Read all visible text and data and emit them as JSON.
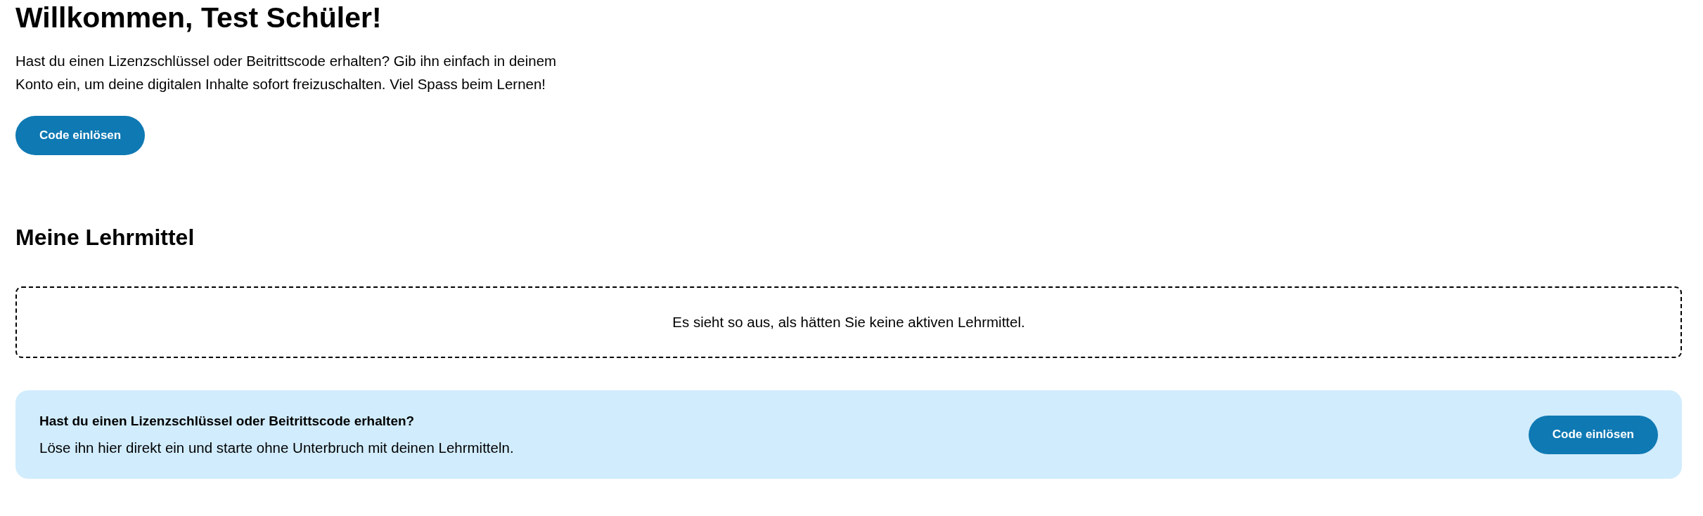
{
  "welcome": {
    "title": "Willkommen, Test Schüler!",
    "text": "Hast du einen Lizenzschlüssel oder Beitrittscode erhalten? Gib ihn einfach in deinem Konto ein, um deine digitalen Inhalte sofort freizuschalten. Viel Spass beim Lernen!",
    "button": "Code einlösen"
  },
  "materials": {
    "title": "Meine Lehrmittel",
    "empty_message": "Es sieht so aus, als hätten Sie keine aktiven Lehrmittel."
  },
  "banner": {
    "title": "Hast du einen Lizenzschlüssel oder Beitrittscode erhalten?",
    "text": "Löse ihn hier direkt ein und starte ohne Unterbruch mit deinen Lehrmitteln.",
    "button": "Code einlösen"
  }
}
